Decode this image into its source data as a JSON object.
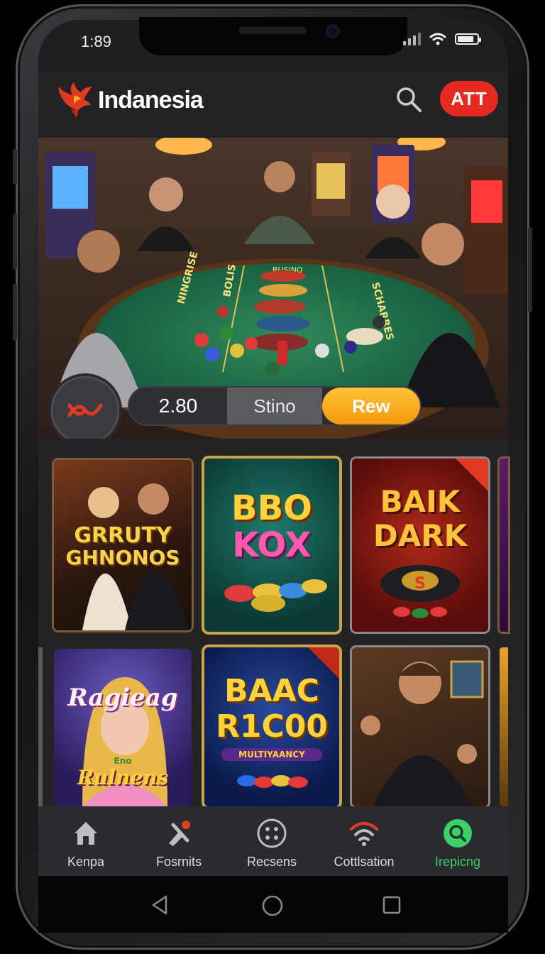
{
  "status": {
    "time": "1:89"
  },
  "header": {
    "brand": "Indanesia",
    "action_label": "ATT"
  },
  "hero": {
    "value": "2.80",
    "middle_label": "Stino",
    "button_label": "Rew",
    "table_marks": [
      "BUSINO",
      "NINGRISE",
      "BOLIS",
      "SCHARRES"
    ]
  },
  "tiles": [
    {
      "title_line1": "GRRUTY",
      "title_line2": "GHNONOS"
    },
    {
      "title_line1": "BBO",
      "title_line2": "KOX"
    },
    {
      "title_line1": "BAIK",
      "title_line2": "DARK",
      "chip_label": "S"
    },
    {
      "title_line1": "Ragieag",
      "title_line2": "Rulnens",
      "tag": "Eno"
    },
    {
      "title_line1": "BAAC",
      "title_line2": "R1C00",
      "sub": "MULTIYAANCY"
    },
    {
      "title_line1": "",
      "title_line2": ""
    }
  ],
  "nav": [
    {
      "label": "Kenpa",
      "icon": "home-icon"
    },
    {
      "label": "Fosrnits",
      "icon": "tools-icon"
    },
    {
      "label": "Recsens",
      "icon": "grid-dots-icon"
    },
    {
      "label": "Cottlsation",
      "icon": "wifi-icon"
    },
    {
      "label": "Irepicng",
      "icon": "search-badge-icon",
      "active": true
    }
  ],
  "colors": {
    "accent": "#e52b1f",
    "active": "#3ccf6a",
    "gold": "#f5a20b"
  }
}
